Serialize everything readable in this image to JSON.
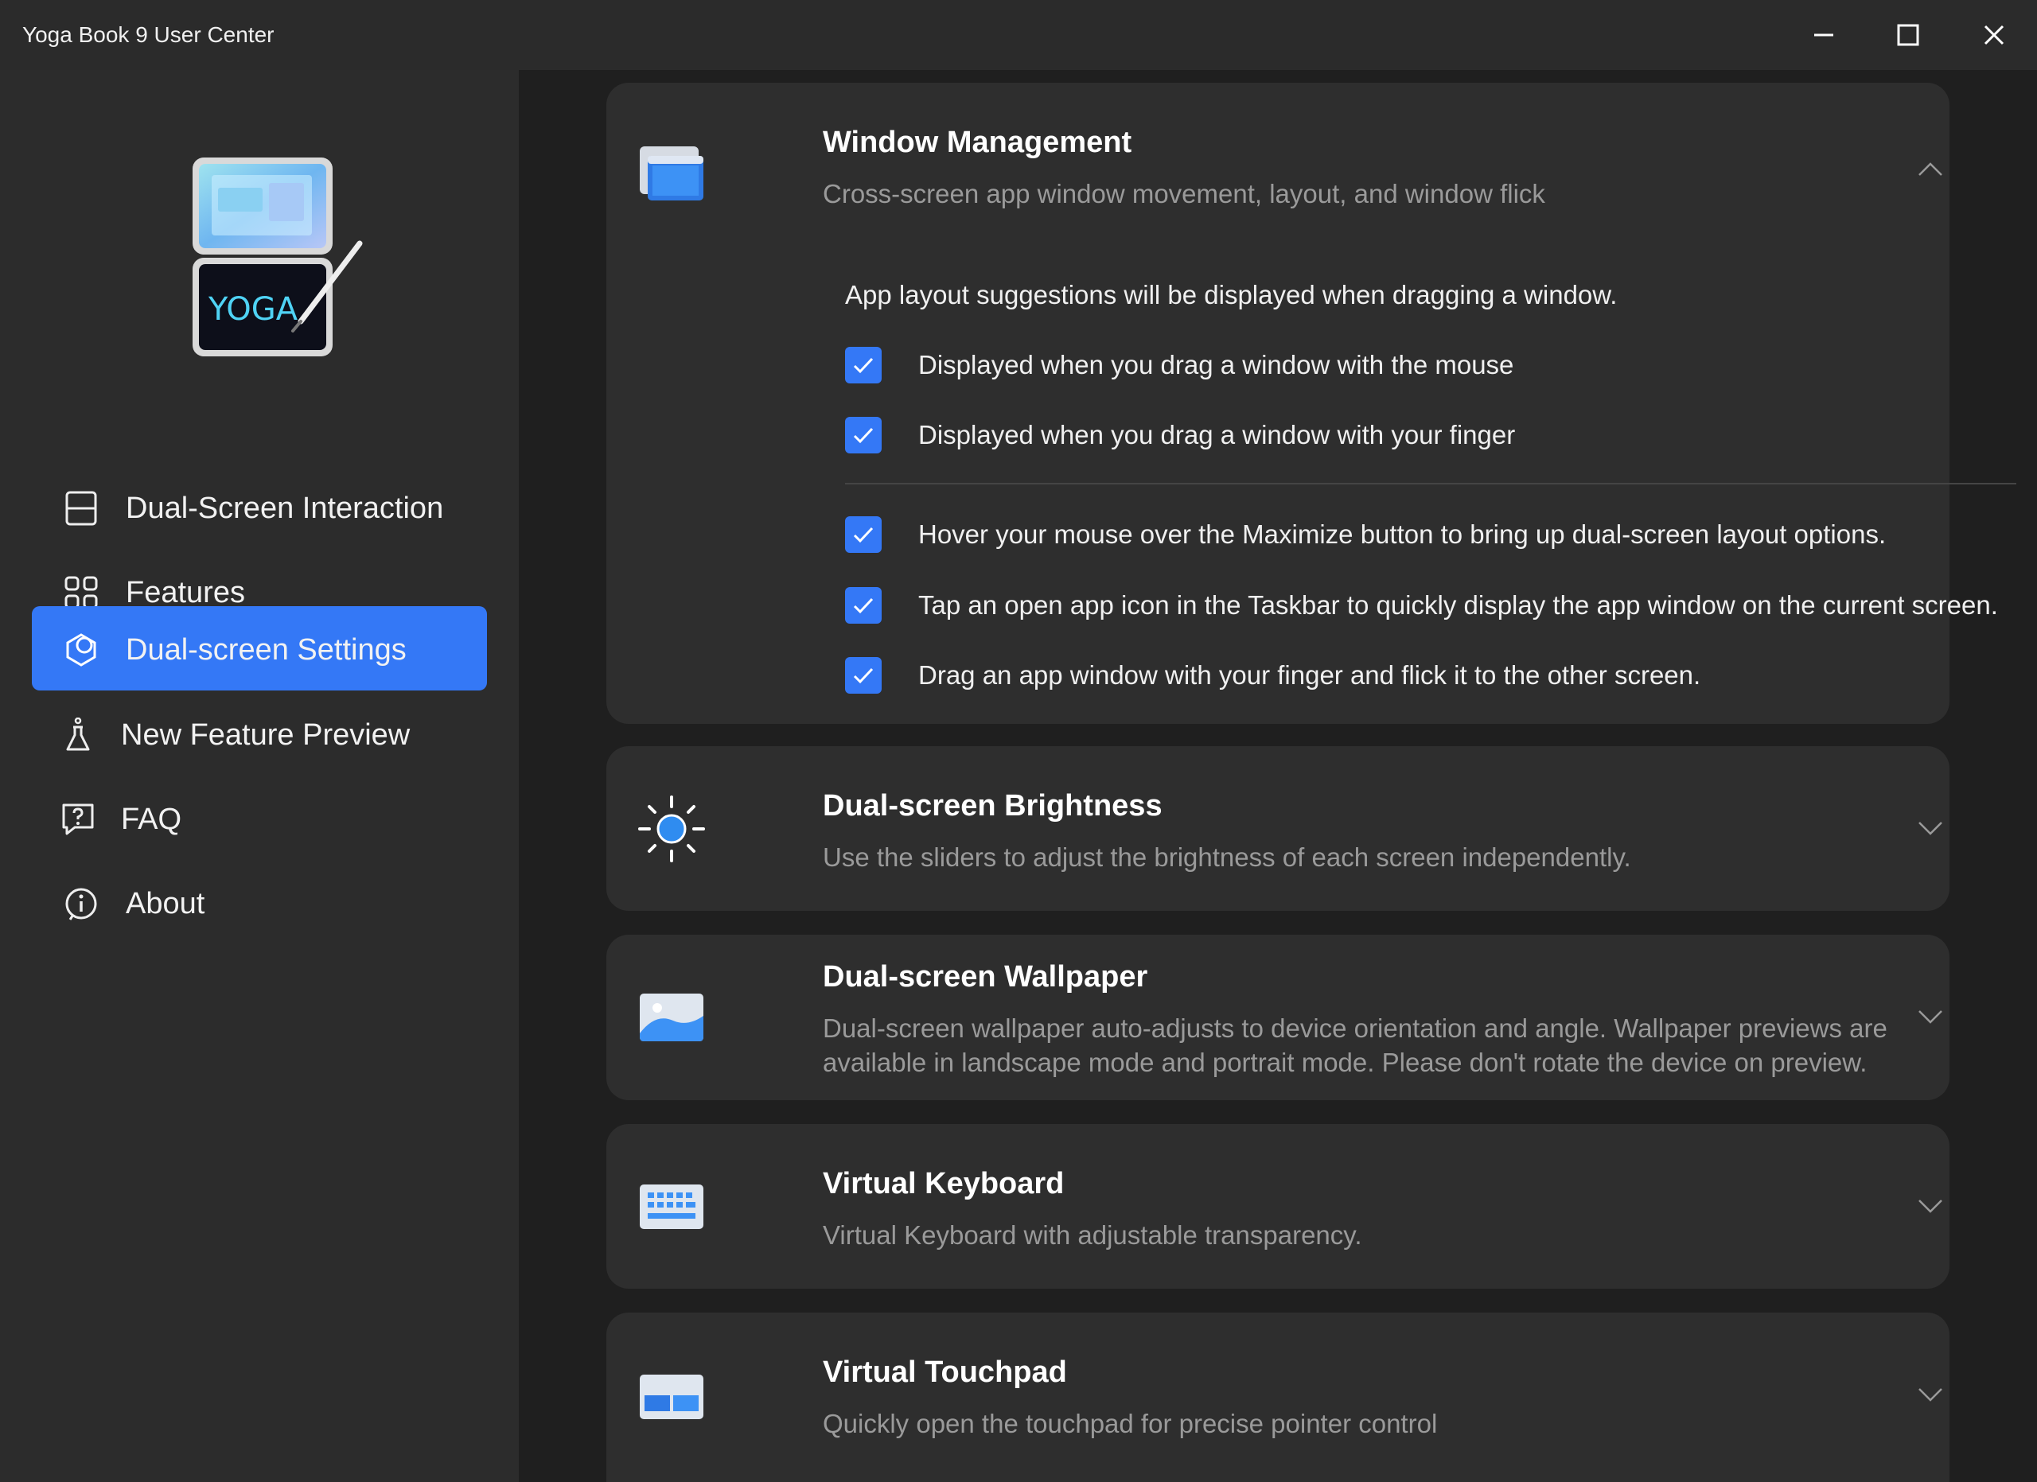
{
  "app": {
    "title": "Yoga Book 9 User Center",
    "accent_color": "#3478f6"
  },
  "window_controls": {
    "minimize_icon": "minimize-icon",
    "maximize_icon": "maximize-icon",
    "close_icon": "close-icon"
  },
  "sidebar": {
    "logo_text": "YOGA",
    "items": [
      {
        "label": "Dual-Screen Interaction",
        "icon": "dual-screen-icon",
        "active": false
      },
      {
        "label": "Features",
        "icon": "features-grid-icon",
        "active": false
      },
      {
        "label": "Dual-screen Settings",
        "icon": "settings-icon",
        "active": true
      },
      {
        "label": "New Feature Preview",
        "icon": "flask-icon",
        "active": false
      },
      {
        "label": "FAQ",
        "icon": "question-icon",
        "active": false
      },
      {
        "label": "About",
        "icon": "info-icon",
        "active": false
      }
    ]
  },
  "sections": [
    {
      "title": "Window Management",
      "description": "Cross-screen app window movement, layout, and window flick",
      "icon": "window-icon",
      "expanded": true,
      "intro": "App layout suggestions will be displayed when dragging a window.",
      "options": [
        {
          "label": "Displayed when you drag a window with the mouse",
          "checked": true
        },
        {
          "label": "Displayed when you drag a window with your finger",
          "checked": true
        },
        {
          "label": "Hover your mouse over the Maximize button to bring up dual-screen layout options.",
          "checked": true
        },
        {
          "label": "Tap an open app icon in the Taskbar to quickly display the app window on the current screen.",
          "checked": true
        },
        {
          "label": "Drag an app window with your finger and flick it to the other screen.",
          "checked": true
        }
      ]
    },
    {
      "title": "Dual-screen Brightness",
      "description": "Use the sliders to adjust the brightness of each screen independently.",
      "icon": "brightness-icon",
      "expanded": false
    },
    {
      "title": "Dual-screen Wallpaper",
      "description": "Dual-screen wallpaper auto-adjusts to device orientation and angle. Wallpaper previews are available in landscape mode and portrait mode. Please don't rotate the device on preview.",
      "icon": "wallpaper-icon",
      "expanded": false
    },
    {
      "title": "Virtual Keyboard",
      "description": "Virtual Keyboard with adjustable transparency.",
      "icon": "keyboard-icon",
      "expanded": false
    },
    {
      "title": "Virtual Touchpad",
      "description": "Quickly open the touchpad for precise pointer control",
      "icon": "touchpad-icon",
      "expanded": false
    }
  ]
}
